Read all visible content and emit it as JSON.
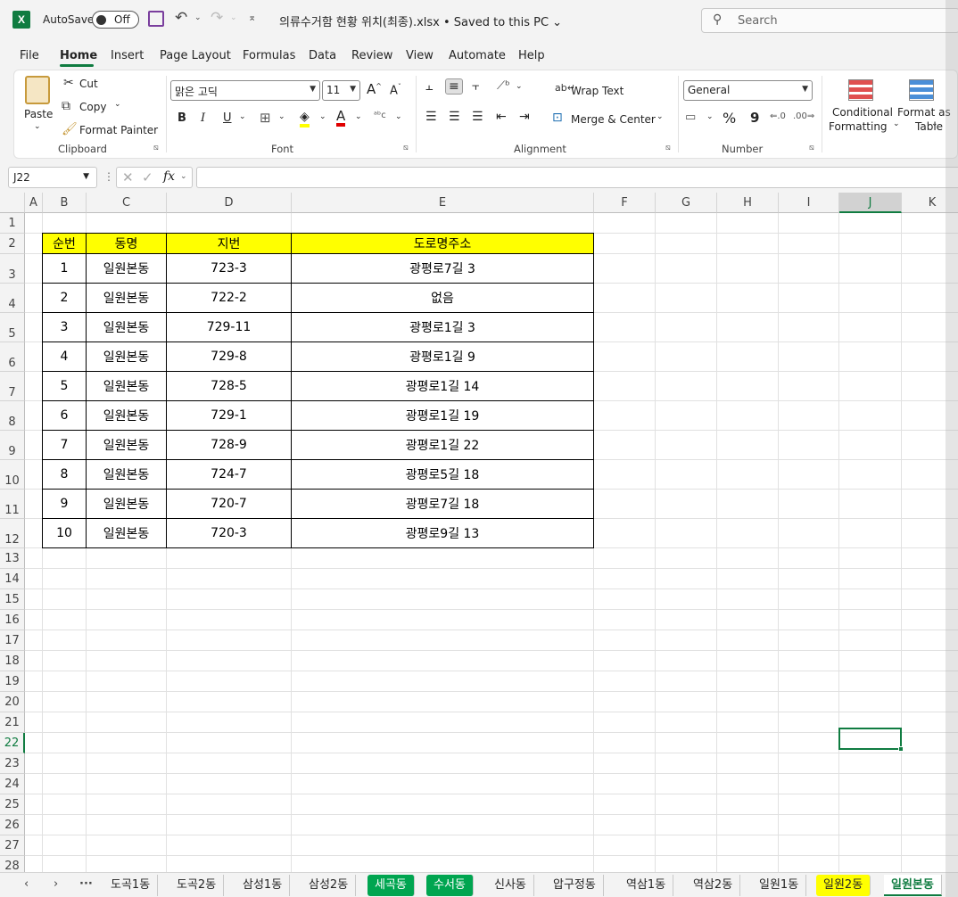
{
  "titlebar": {
    "app_icon": "excel-logo",
    "autosave_label": "AutoSave",
    "autosave_state": "Off",
    "doc_title": "의류수거함 현황 위치(최종).xlsx • Saved to this PC ⌄",
    "search_placeholder": "Search"
  },
  "menu": [
    "File",
    "Home",
    "Insert",
    "Page Layout",
    "Formulas",
    "Data",
    "Review",
    "View",
    "Automate",
    "Help"
  ],
  "ribbon": {
    "clipboard": {
      "paste": "Paste",
      "cut": "Cut",
      "copy": "Copy",
      "format_painter": "Format Painter",
      "label": "Clipboard"
    },
    "font": {
      "name": "맑은 고딕",
      "size": "11",
      "bold": "B",
      "italic": "I",
      "underline": "U",
      "label": "Font"
    },
    "alignment": {
      "wrap": "Wrap Text",
      "merge": "Merge & Center",
      "label": "Alignment"
    },
    "number": {
      "format": "General",
      "percent": "%",
      "comma": "9",
      "label": "Number"
    },
    "styles": {
      "conditional_1": "Conditional",
      "conditional_2": "Formatting",
      "format_as_1": "Format as",
      "format_as_2": "Table"
    }
  },
  "formula_bar": {
    "name_box": "J22",
    "fx": "fx",
    "formula": ""
  },
  "columns": [
    "A",
    "B",
    "C",
    "D",
    "E",
    "F",
    "G",
    "H",
    "I",
    "J",
    "K"
  ],
  "selected_column": "J",
  "selected_row": "22",
  "table": {
    "headers": [
      "순번",
      "동명",
      "지번",
      "도로명주소"
    ],
    "rows": [
      [
        "1",
        "일원본동",
        "723-3",
        "광평로7길 3"
      ],
      [
        "2",
        "일원본동",
        "722-2",
        "없음"
      ],
      [
        "3",
        "일원본동",
        "729-11",
        "광평로1길 3"
      ],
      [
        "4",
        "일원본동",
        "729-8",
        "광평로1길 9"
      ],
      [
        "5",
        "일원본동",
        "728-5",
        "광평로1길 14"
      ],
      [
        "6",
        "일원본동",
        "729-1",
        "광평로1길 19"
      ],
      [
        "7",
        "일원본동",
        "728-9",
        "광평로1길 22"
      ],
      [
        "8",
        "일원본동",
        "724-7",
        "광평로5길 18"
      ],
      [
        "9",
        "일원본동",
        "720-7",
        "광평로7길 18"
      ],
      [
        "10",
        "일원본동",
        "720-3",
        "광평로9길 13"
      ]
    ]
  },
  "sheet_tabs": [
    {
      "name": "도곡1동",
      "style": "normal"
    },
    {
      "name": "도곡2동",
      "style": "normal"
    },
    {
      "name": "삼성1동",
      "style": "normal"
    },
    {
      "name": "삼성2동",
      "style": "normal"
    },
    {
      "name": "세곡동",
      "style": "green"
    },
    {
      "name": "수서동",
      "style": "green"
    },
    {
      "name": "신사동",
      "style": "normal"
    },
    {
      "name": "압구정동",
      "style": "normal"
    },
    {
      "name": "역삼1동",
      "style": "normal"
    },
    {
      "name": "역삼2동",
      "style": "normal"
    },
    {
      "name": "일원1동",
      "style": "normal"
    },
    {
      "name": "일원2동",
      "style": "yellow"
    },
    {
      "name": "일원본동",
      "style": "active"
    }
  ],
  "colors": {
    "accent": "#107c41",
    "header_fill": "#ffff00",
    "tab_green": "#00a550"
  }
}
